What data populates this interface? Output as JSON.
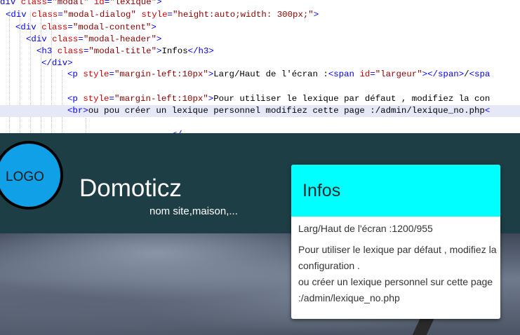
{
  "code": {
    "lines": [
      {
        "parts": [
          [
            "t",
            "div "
          ],
          [
            "a",
            "class"
          ],
          [
            "t",
            "="
          ],
          [
            "v",
            "\"modal\""
          ],
          [
            "t",
            " "
          ],
          [
            "a",
            "id"
          ],
          [
            "t",
            "="
          ],
          [
            "v",
            "\"lexique\""
          ],
          [
            "t",
            ">"
          ]
        ]
      },
      {
        "parts": [
          [
            "t",
            "<div "
          ],
          [
            "a",
            "class"
          ],
          [
            "t",
            "="
          ],
          [
            "v",
            "\"modal-dialog\""
          ],
          [
            "t",
            " "
          ],
          [
            "a",
            "style"
          ],
          [
            "t",
            "="
          ],
          [
            "v",
            "\"height:auto;width: 300px;\""
          ],
          [
            "t",
            ">"
          ]
        ]
      },
      {
        "parts": [
          [
            "t",
            "<div "
          ],
          [
            "a",
            "class"
          ],
          [
            "t",
            "="
          ],
          [
            "v",
            "\"modal-content\""
          ],
          [
            "t",
            ">"
          ]
        ]
      },
      {
        "parts": [
          [
            "t",
            "<div "
          ],
          [
            "a",
            "class"
          ],
          [
            "t",
            "="
          ],
          [
            "v",
            "\"modal-header\""
          ],
          [
            "t",
            ">"
          ]
        ]
      },
      {
        "parts": [
          [
            "t",
            "<h3 "
          ],
          [
            "a",
            "class"
          ],
          [
            "t",
            "="
          ],
          [
            "v",
            "\"modal-title\""
          ],
          [
            "t",
            ">"
          ],
          [
            "x",
            "Infos"
          ],
          [
            "t",
            "</h3>"
          ]
        ]
      },
      {
        "parts": [
          [
            "t",
            "</div>"
          ]
        ]
      },
      {
        "parts": [
          [
            "t",
            "<p "
          ],
          [
            "a",
            "style"
          ],
          [
            "t",
            "="
          ],
          [
            "v",
            "\"margin-left:10px\""
          ],
          [
            "t",
            ">"
          ],
          [
            "x",
            "Larg/Haut de l'écran :"
          ],
          [
            "t",
            "<span "
          ],
          [
            "a",
            "id"
          ],
          [
            "t",
            "="
          ],
          [
            "v",
            "\"largeur\""
          ],
          [
            "t",
            "></span>"
          ],
          [
            "x",
            "/"
          ],
          [
            "t",
            "<spa"
          ]
        ]
      },
      {
        "parts": []
      },
      {
        "parts": [
          [
            "t",
            "<p "
          ],
          [
            "a",
            "style"
          ],
          [
            "t",
            "="
          ],
          [
            "v",
            "\"margin-left:10px\""
          ],
          [
            "t",
            ">"
          ],
          [
            "x",
            "Pour utiliser le lexique par défaut , modifiez la con"
          ]
        ]
      },
      {
        "parts": [
          [
            "t",
            "<br>"
          ],
          [
            "x",
            "ou pou créer un lexique personnel modifiez cette page :/admin/lexique_no.php"
          ],
          [
            "t",
            "<"
          ]
        ]
      },
      {
        "parts": []
      },
      {
        "parts": [
          [
            "x",
            "                    "
          ],
          [
            "t",
            "</"
          ]
        ]
      }
    ]
  },
  "site": {
    "logo_text": "LOGO",
    "title": "Domoticz",
    "tagline": "nom site,maison,..."
  },
  "modal": {
    "title": "Infos",
    "screen_label": "Larg/Haut de l'écran :",
    "screen_value": "1200/955",
    "lexicon_line1": "Pour utiliser le lexique par défaut , modifiez la configuration .",
    "lexicon_line2": "ou créer un lexique personnel sur cette page :/admin/lexique_no.php"
  },
  "colors": {
    "header_bg": "#1e3e45",
    "modal_header_bg": "#00ffff",
    "logo_fill": "#0fa0e8",
    "code_tag": "#0000ee",
    "code_attr": "#d40000",
    "code_value": "#8a0000",
    "code_highlight": "#e6e8f8"
  }
}
